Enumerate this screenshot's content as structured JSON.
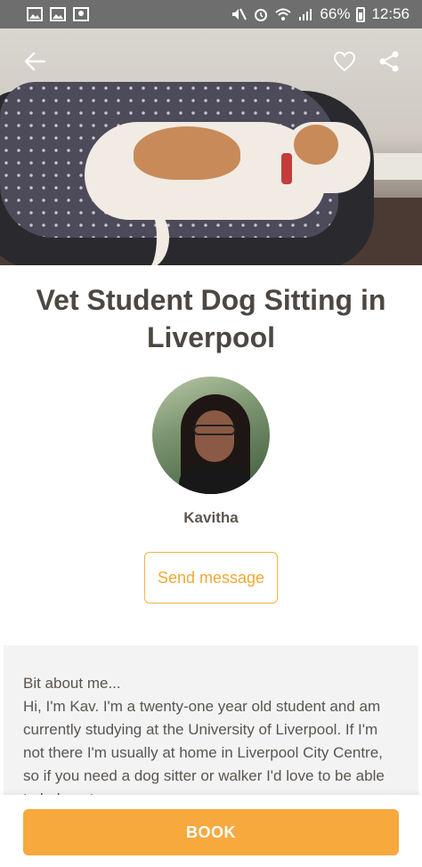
{
  "status_bar": {
    "battery": "66%",
    "time": "12:56",
    "icons_left": [
      "image-icon",
      "image-icon",
      "map-pin-icon"
    ],
    "icons_right": [
      "mute-icon",
      "alarm-icon",
      "wifi-icon",
      "signal-icon",
      "battery-icon"
    ]
  },
  "hero": {
    "image": "dog-on-bed-photo"
  },
  "header": {
    "back_icon": "arrow-left-icon",
    "favorite_icon": "heart-icon",
    "share_icon": "share-icon"
  },
  "listing": {
    "title": "Vet Student Dog Sitting in Liverpool"
  },
  "host": {
    "name": "Kavitha",
    "avatar": "avatar-photo"
  },
  "actions": {
    "send_message_label": "Send message",
    "book_label": "BOOK"
  },
  "about": {
    "heading": "Bit about me...",
    "text": "Hi, I'm Kav. I'm a twenty-one year old student and am currently studying at the University of Liverpool. If I'm not there I'm usually at home in Liverpool City Centre, so if you need a dog sitter or walker I'd love to be able to help out."
  },
  "colors": {
    "accent": "#f7a93e",
    "accent_text": "#f0a935",
    "status_bar": "#6e6e6e",
    "about_bg": "#f3f3f3"
  }
}
